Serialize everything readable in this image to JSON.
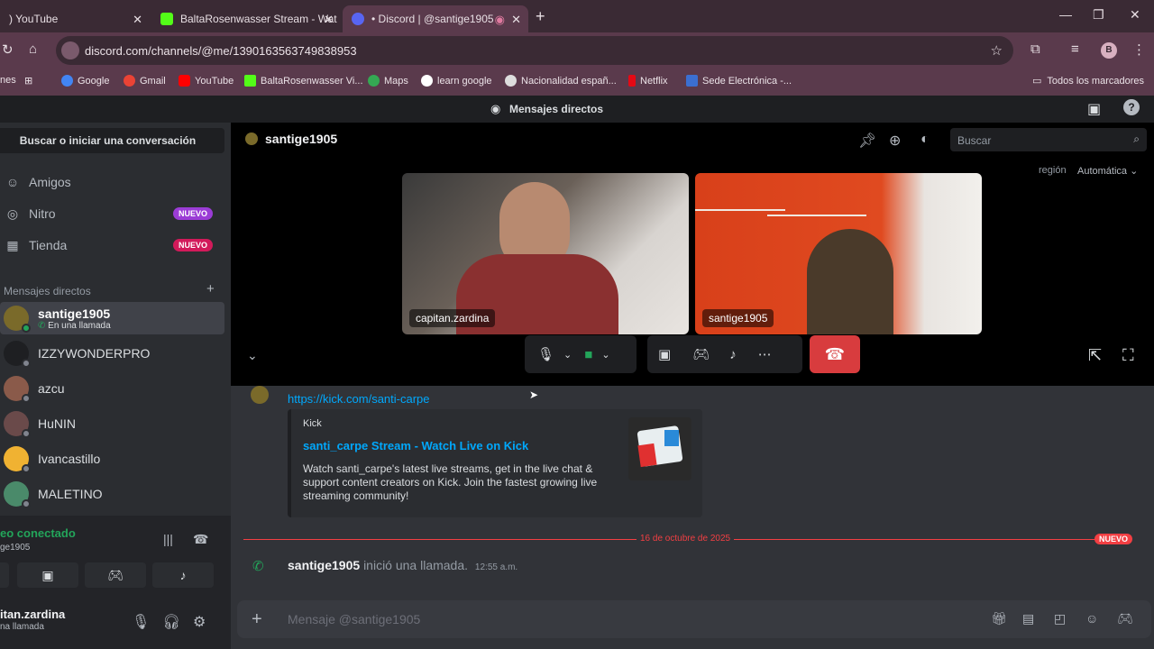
{
  "browser": {
    "tabs": [
      {
        "title": ") YouTube"
      },
      {
        "title": "BaltaRosenwasser Stream - Wat"
      },
      {
        "title": "• Discord | @santige1905"
      }
    ],
    "url": "discord.com/channels/@me/1390163563749838953",
    "bookmarks": [
      {
        "label": "Google",
        "color": "#4285f4"
      },
      {
        "label": "Gmail",
        "color": "#ea4335"
      },
      {
        "label": "YouTube",
        "color": "#ff0000"
      },
      {
        "label": "BaltaRosenwasser Vi...",
        "color": "#53fc18"
      },
      {
        "label": "Maps",
        "color": "#34a853"
      },
      {
        "label": "learn google",
        "color": "#ffffff"
      },
      {
        "label": "Nacionalidad españ...",
        "color": "#dddddd"
      },
      {
        "label": "Netflix",
        "color": "#e50914"
      },
      {
        "label": "Sede Electrónica -...",
        "color": "#3b6fd1"
      }
    ],
    "all_bookmarks": "Todos los marcadores",
    "profile_initial": "B"
  },
  "discord": {
    "title": "Mensajes directos",
    "sidebar": {
      "search_label": "Buscar o iniciar una conversación",
      "nav": [
        {
          "label": "Amigos",
          "badge": ""
        },
        {
          "label": "Nitro",
          "badge": "NUEVO"
        },
        {
          "label": "Tienda",
          "badge": "NUEVO"
        }
      ],
      "dm_header": "Mensajes directos",
      "dms": [
        {
          "name": "santige1905",
          "status": "En una llamada",
          "color": "#7a6a2a"
        },
        {
          "name": "IZZYWONDERPRO",
          "status": "",
          "color": "#1e1f22"
        },
        {
          "name": "azcu",
          "status": "",
          "color": "#8a5a4a"
        },
        {
          "name": "HuNIN",
          "status": "",
          "color": "#6a4a4a"
        },
        {
          "name": "Ivancastillo",
          "status": "",
          "color": "#f0b232"
        },
        {
          "name": "MALETINO",
          "status": "",
          "color": "#4a8a6a"
        }
      ],
      "voice_status": "eo conectado",
      "voice_channel": "ge1905",
      "username": "itan.zardina",
      "user_status": "na llamada"
    },
    "call": {
      "header_name": "santige1905",
      "search_placeholder": "Buscar",
      "region_label": "región",
      "region_value": "Automática",
      "participants": [
        {
          "name": "capitan.zardina"
        },
        {
          "name": "santige1905"
        }
      ]
    },
    "chat": {
      "link": "https://kick.com/santi-carpe",
      "embed": {
        "provider": "Kick",
        "title": "santi_carpe Stream - Watch Live on Kick",
        "description": "Watch santi_carpe's latest live streams, get in the live chat & support content creators on Kick. Join the fastest growing live streaming community!"
      },
      "divider_date": "16 de octubre de 2025",
      "new_label": "NUEVO",
      "system_msg": {
        "user": "santige1905",
        "text": "inició una llamada.",
        "time": "12:55 a.m."
      },
      "composer_placeholder": "Mensaje @santige1905"
    }
  }
}
